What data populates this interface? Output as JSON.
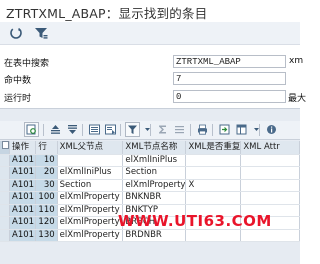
{
  "window": {
    "title": "ZTRTXML_ABAP：显示找到的条目"
  },
  "toolbar": {
    "icons": [
      "execute-icon",
      "filter-settings-icon"
    ]
  },
  "info": {
    "search_table_label": "在表中搜索",
    "search_table_value": "ZTRTXML_ABAP",
    "search_table_right": "xm",
    "hits_label": "命中数",
    "hits_value": "7",
    "runtime_label": "运行时",
    "runtime_value": "0",
    "runtime_right": "最大"
  },
  "grid_toolbar": {
    "icons": [
      "details-icon",
      "sort-ascending-icon",
      "sort-descending-icon",
      "find-icon",
      "find-next-icon",
      "filter-icon",
      "filter-dropdown-icon",
      "sum-icon",
      "subtotal-icon",
      "print-icon",
      "export-icon",
      "layout-icon",
      "layout-dropdown-icon",
      "info-icon"
    ]
  },
  "table": {
    "columns": [
      "操作",
      "行",
      "XML父节点",
      "XML节点名称",
      "XML是否重复",
      "XML Attr"
    ],
    "rows": [
      [
        "A101",
        "10",
        "",
        "elXmlIniPlus",
        "",
        ""
      ],
      [
        "A101",
        "20",
        "elXmlIniPlus",
        "Section",
        "",
        ""
      ],
      [
        "A101",
        "30",
        "Section",
        "elXmlProperty",
        "X",
        ""
      ],
      [
        "A101",
        "100",
        "elXmlProperty",
        "BNKNBR",
        "",
        ""
      ],
      [
        "A101",
        "110",
        "elXmlProperty",
        "BNKTYP",
        "",
        ""
      ],
      [
        "A101",
        "120",
        "elXmlProperty",
        "BRBCH",
        "",
        ""
      ],
      [
        "A101",
        "130",
        "elXmlProperty",
        "BRDNBR",
        "",
        ""
      ]
    ]
  },
  "watermark": {
    "text": "WWW.UTI63.COM"
  }
}
